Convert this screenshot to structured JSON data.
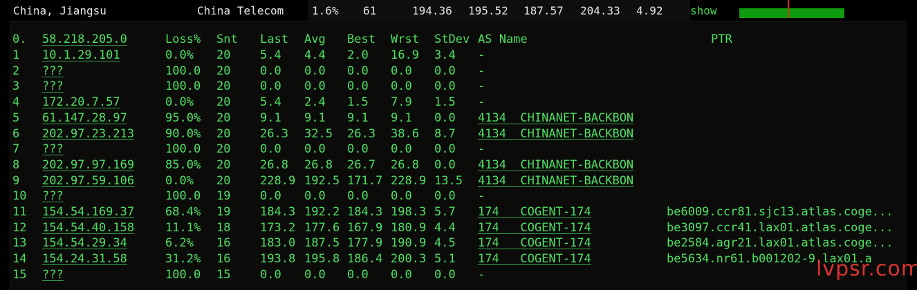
{
  "topbar": {
    "location": "China, Jiangsu",
    "isp": "China Telecom",
    "loss": "1.6%",
    "sent": "61",
    "last": "194.36",
    "avg": "195.52",
    "best": "187.57",
    "worst": "204.33",
    "stdev": "4.92",
    "show_label": "show",
    "bar_color": "#0f9b0f",
    "tick_color": "#e02a1a"
  },
  "table": {
    "headers": {
      "idx": "0.",
      "host": "58.218.205.0",
      "loss": "Loss%",
      "snt": "Snt",
      "last": "Last",
      "avg": "Avg",
      "best": "Best",
      "wrst": "Wrst",
      "stdev": "StDev",
      "as": "AS Name",
      "ptr": "PTR"
    },
    "rows": [
      {
        "idx": "1",
        "host": "10.1.29.101",
        "loss": "0.0%",
        "snt": "20",
        "last": "5.4",
        "avg": "4.4",
        "best": "2.0",
        "wrst": "16.9",
        "stdev": "3.4",
        "as": "-",
        "ptr": ""
      },
      {
        "idx": "2",
        "host": "???",
        "loss": "100.0",
        "snt": "20",
        "last": "0.0",
        "avg": "0.0",
        "best": "0.0",
        "wrst": "0.0",
        "stdev": "0.0",
        "as": "-",
        "ptr": ""
      },
      {
        "idx": "3",
        "host": "???",
        "loss": "100.0",
        "snt": "20",
        "last": "0.0",
        "avg": "0.0",
        "best": "0.0",
        "wrst": "0.0",
        "stdev": "0.0",
        "as": "-",
        "ptr": ""
      },
      {
        "idx": "4",
        "host": "172.20.7.57",
        "loss": "0.0%",
        "snt": "20",
        "last": "5.4",
        "avg": "2.4",
        "best": "1.5",
        "wrst": "7.9",
        "stdev": "1.5",
        "as": "-",
        "ptr": ""
      },
      {
        "idx": "5",
        "host": "61.147.28.97",
        "loss": "95.0%",
        "snt": "20",
        "last": "9.1",
        "avg": "9.1",
        "best": "9.1",
        "wrst": "9.1",
        "stdev": "0.0",
        "as": "4134  CHINANET-BACKBON",
        "ptr": ""
      },
      {
        "idx": "6",
        "host": "202.97.23.213",
        "loss": "90.0%",
        "snt": "20",
        "last": "26.3",
        "avg": "32.5",
        "best": "26.3",
        "wrst": "38.6",
        "stdev": "8.7",
        "as": "4134  CHINANET-BACKBON",
        "ptr": ""
      },
      {
        "idx": "7",
        "host": "???",
        "loss": "100.0",
        "snt": "20",
        "last": "0.0",
        "avg": "0.0",
        "best": "0.0",
        "wrst": "0.0",
        "stdev": "0.0",
        "as": "-",
        "ptr": ""
      },
      {
        "idx": "8",
        "host": "202.97.97.169",
        "loss": "85.0%",
        "snt": "20",
        "last": "26.8",
        "avg": "26.8",
        "best": "26.7",
        "wrst": "26.8",
        "stdev": "0.0",
        "as": "4134  CHINANET-BACKBON",
        "ptr": ""
      },
      {
        "idx": "9",
        "host": "202.97.59.106",
        "loss": "0.0%",
        "snt": "20",
        "last": "228.9",
        "avg": "192.5",
        "best": "171.7",
        "wrst": "228.9",
        "stdev": "13.5",
        "as": "4134  CHINANET-BACKBON",
        "ptr": ""
      },
      {
        "idx": "10",
        "host": "???",
        "loss": "100.0",
        "snt": "19",
        "last": "0.0",
        "avg": "0.0",
        "best": "0.0",
        "wrst": "0.0",
        "stdev": "0.0",
        "as": "-",
        "ptr": ""
      },
      {
        "idx": "11",
        "host": "154.54.169.37",
        "loss": "68.4%",
        "snt": "19",
        "last": "184.3",
        "avg": "192.2",
        "best": "184.3",
        "wrst": "198.3",
        "stdev": "5.7",
        "as": "174   COGENT-174",
        "ptr": "be6009.ccr81.sjc13.atlas.coge..."
      },
      {
        "idx": "12",
        "host": "154.54.40.158",
        "loss": "11.1%",
        "snt": "18",
        "last": "173.2",
        "avg": "177.6",
        "best": "167.9",
        "wrst": "180.9",
        "stdev": "4.4",
        "as": "174   COGENT-174",
        "ptr": "be3097.ccr41.lax01.atlas.coge..."
      },
      {
        "idx": "13",
        "host": "154.54.29.34",
        "loss": "6.2%",
        "snt": "16",
        "last": "183.0",
        "avg": "187.5",
        "best": "177.9",
        "wrst": "190.9",
        "stdev": "4.5",
        "as": "174   COGENT-174",
        "ptr": "be2584.agr21.lax01.atlas.coge..."
      },
      {
        "idx": "14",
        "host": "154.24.31.58",
        "loss": "31.2%",
        "snt": "16",
        "last": "193.8",
        "avg": "195.8",
        "best": "186.4",
        "wrst": "200.3",
        "stdev": "5.1",
        "as": "174   COGENT-174",
        "ptr": "be5634.nr61.b001202-9.lax01.a"
      },
      {
        "idx": "15",
        "host": "???",
        "loss": "100.0",
        "snt": "15",
        "last": "0.0",
        "avg": "0.0",
        "best": "0.0",
        "wrst": "0.0",
        "stdev": "0.0",
        "as": "-",
        "ptr": ""
      }
    ]
  },
  "watermark": "lvpsr.com",
  "colors": {
    "text_green": "#4fe063",
    "background": "#0b0b0a"
  }
}
